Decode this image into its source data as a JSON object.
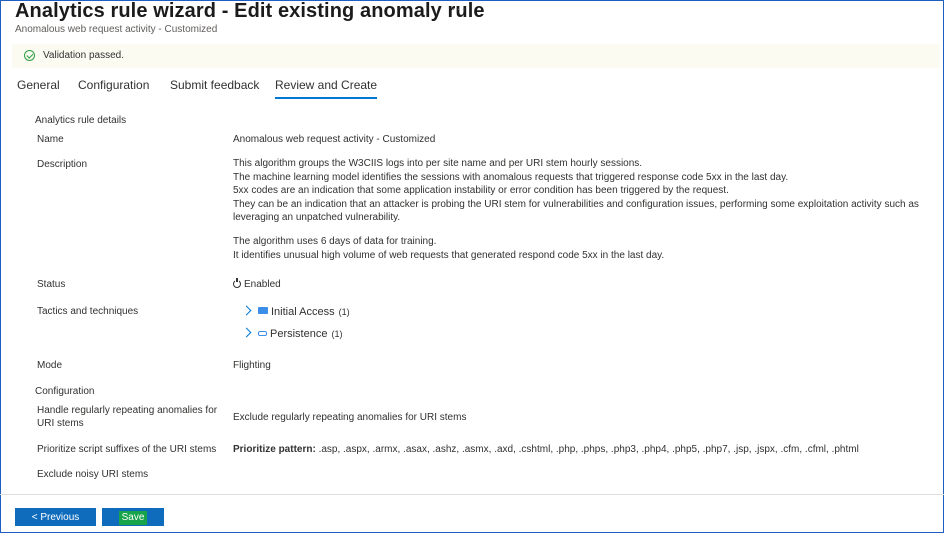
{
  "header": {
    "title": "Analytics rule wizard - Edit existing anomaly rule",
    "more": "···",
    "subtitle": "Anomalous web request activity - Customized"
  },
  "banner": {
    "message": "Validation passed."
  },
  "tabs": [
    {
      "label": "General"
    },
    {
      "label": "Configuration"
    },
    {
      "label": "Submit feedback"
    },
    {
      "label": "Review and Create",
      "active": true
    }
  ],
  "details": {
    "section_title": "Analytics rule details",
    "name_label": "Name",
    "name_value": "Anomalous web request activity - Customized",
    "description_label": "Description",
    "description_lines": [
      "This algorithm groups the W3CIIS logs into per site name and per URI stem hourly sessions.",
      "The machine learning model identifies the sessions with anomalous requests that triggered response code 5xx in the last day.",
      "5xx codes are an indication that some application instability or error condition has been triggered by the request.",
      "They can be an indication that an attacker is probing the URI stem for vulnerabilities and configuration issues, performing some exploitation activity such as",
      "leveraging an unpatched vulnerability.",
      "The algorithm uses 6 days of data for training.",
      "It identifies unusual high volume of web requests that generated respond code 5xx in the last day."
    ],
    "status_label": "Status",
    "status_value": "Enabled",
    "tactics_label": "Tactics and techniques",
    "tactics": [
      {
        "name": "Initial Access",
        "count": "(1)",
        "icon": "initial-access-icon"
      },
      {
        "name": "Persistence",
        "count": "(1)",
        "icon": "persistence-icon"
      }
    ],
    "mode_label": "Mode",
    "mode_value": "Flighting"
  },
  "configuration": {
    "section_title": "Configuration",
    "handle_label": "Handle regularly repeating anomalies for URI stems",
    "handle_value": "Exclude regularly repeating anomalies for URI stems",
    "prioritize_label": "Prioritize script suffixes of the URI stems",
    "prioritize_key": "Prioritize pattern:",
    "prioritize_value": " .asp, .aspx, .armx, .asax, .ashz, .asmx, .axd, .cshtml, .php, .phps, .php3, .php4, .php5, .php7, .jsp, .jspx, .cfm, .cfml, .phtml",
    "exclude_label": "Exclude noisy URI stems"
  },
  "footer": {
    "previous_label": "< Previous",
    "save_label": "Save"
  },
  "colors": {
    "accent": "#0f6cbd",
    "success": "#2e9e44",
    "highlight": "#16a34a"
  }
}
